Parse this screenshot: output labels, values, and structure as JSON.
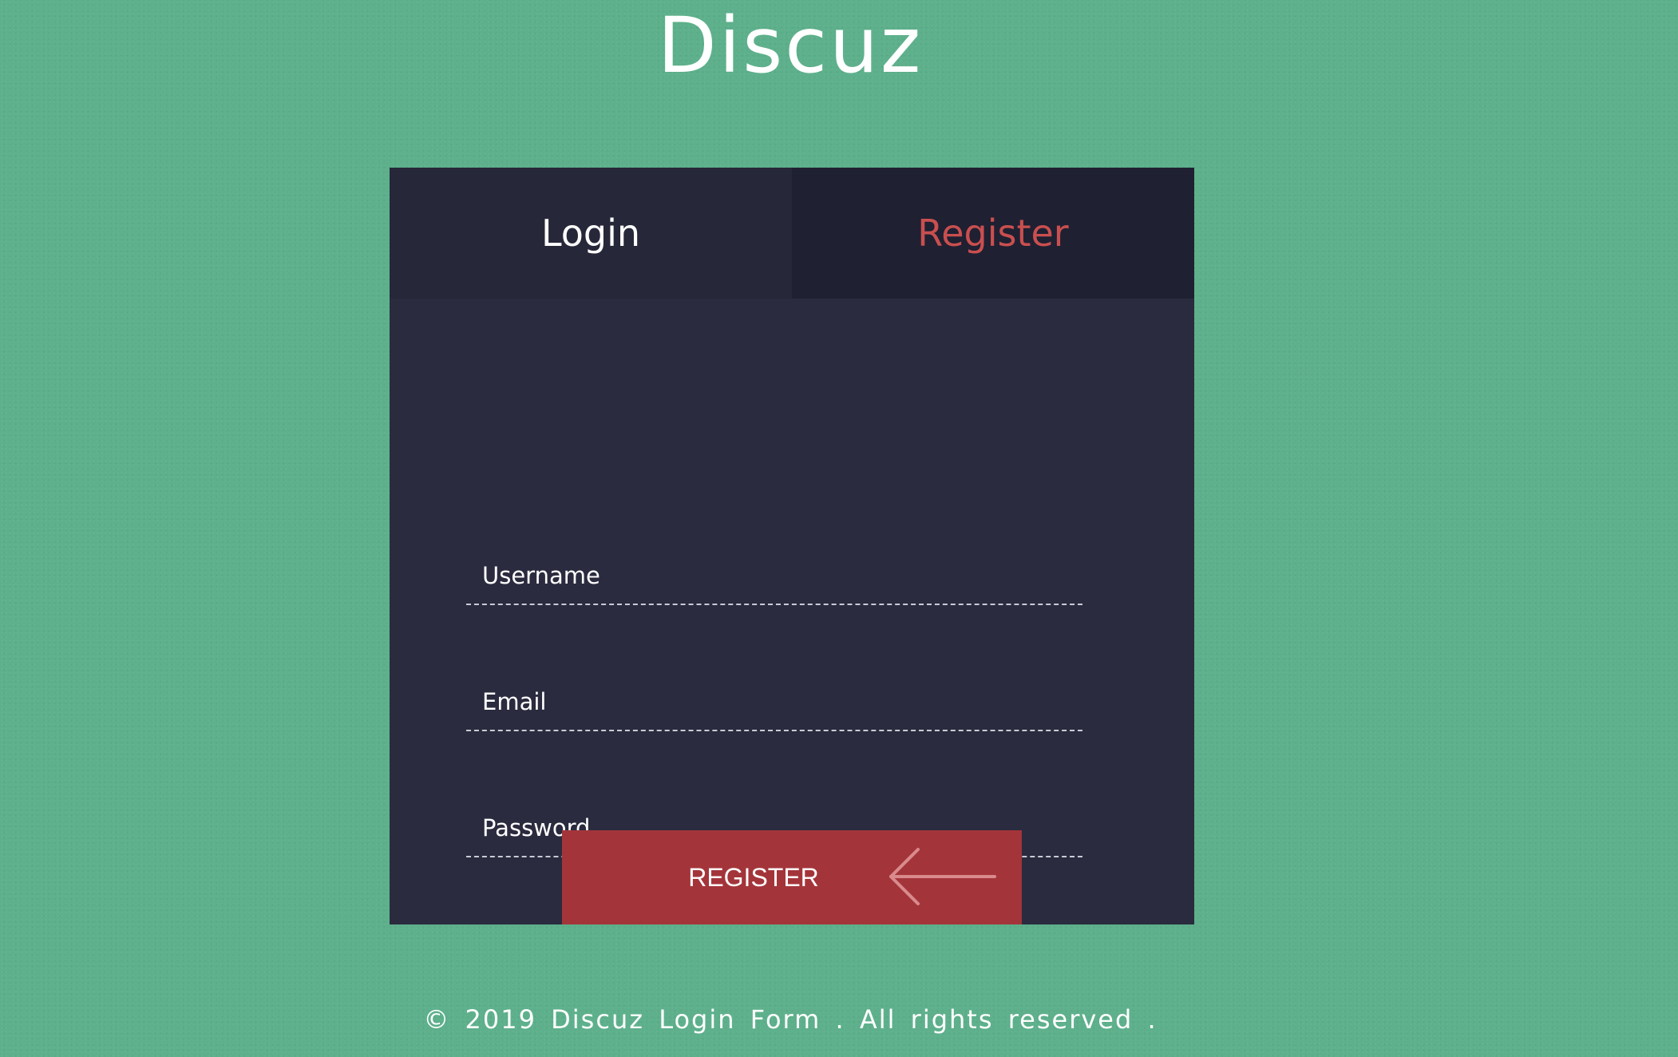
{
  "header": {
    "title": "Discuz"
  },
  "tabs": {
    "login": "Login",
    "register": "Register",
    "active": "register"
  },
  "form": {
    "username_placeholder": "Username",
    "email_placeholder": "Email",
    "password_placeholder": "Password",
    "submit_label": "REGISTER",
    "submit_icon": "arrow-left-icon"
  },
  "footer": {
    "text": "© 2019 Discuz Login Form . All rights reserved ."
  },
  "colors": {
    "background": "#5db08b",
    "panel": "#2a2b3e",
    "active_tab_text": "#c94f4f",
    "button": "#a3353a"
  }
}
